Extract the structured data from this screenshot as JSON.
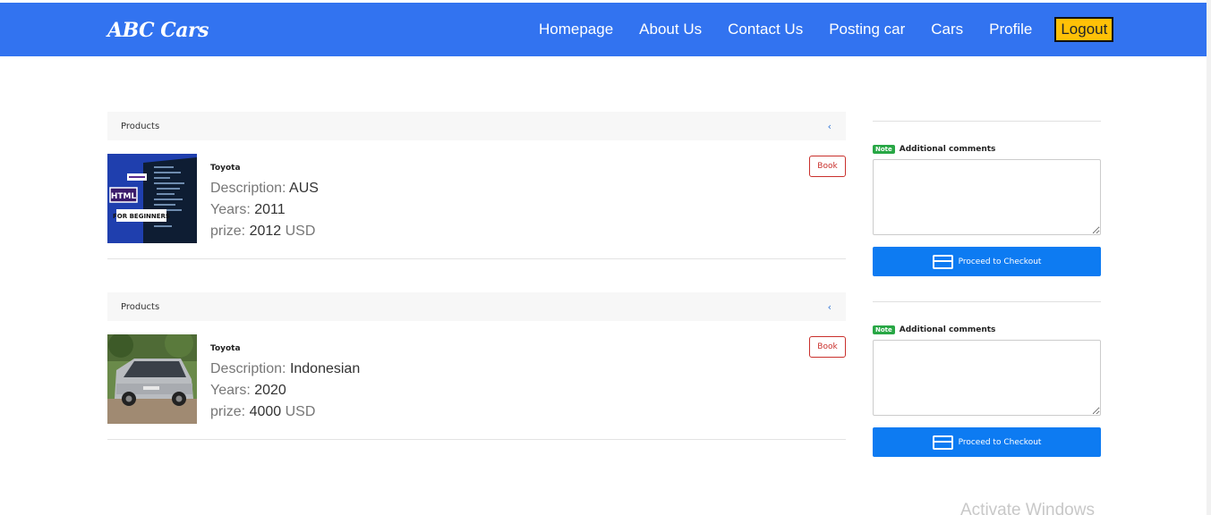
{
  "brand": "ABC Cars",
  "nav": {
    "items": [
      "Homepage",
      "About Us",
      "Contact Us",
      "Posting car",
      "Cars",
      "Profile"
    ],
    "logout": "Logout"
  },
  "products": [
    {
      "header": "Products",
      "maker": "Toyota",
      "description_label": "Description:",
      "description": "AUS",
      "years_label": "Years:",
      "years": "2011",
      "prize_label": "prize:",
      "prize": "2012",
      "currency": "USD",
      "book": "Book",
      "image": "html-for-beginners-thumbnail"
    },
    {
      "header": "Products",
      "maker": "Toyota",
      "description_label": "Description:",
      "description": "Indonesian",
      "years_label": "Years:",
      "years": "2020",
      "prize_label": "prize:",
      "prize": "4000",
      "currency": "USD",
      "book": "Book",
      "image": "silver-minivan-photo"
    }
  ],
  "checkout": [
    {
      "note": "Note",
      "label": "Additional comments",
      "button": "Proceed to Checkout"
    },
    {
      "note": "Note",
      "label": "Additional comments",
      "button": "Proceed to Checkout"
    }
  ],
  "watermark": "Activate Windows",
  "colors": {
    "navbar": "#3273f0",
    "logout": "#ffc107",
    "checkout_button": "#0d7bf2",
    "book_button": "#c9302c",
    "note_badge": "#28a745"
  }
}
